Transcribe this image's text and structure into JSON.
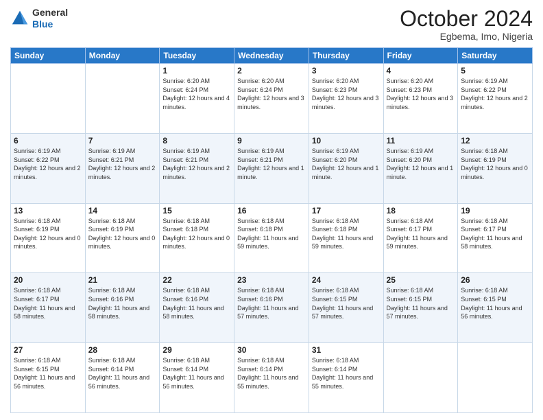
{
  "header": {
    "logo": {
      "line1": "General",
      "line2": "Blue"
    },
    "title": "October 2024",
    "location": "Egbema, Imo, Nigeria"
  },
  "days_of_week": [
    "Sunday",
    "Monday",
    "Tuesday",
    "Wednesday",
    "Thursday",
    "Friday",
    "Saturday"
  ],
  "weeks": [
    [
      {
        "day": "",
        "info": ""
      },
      {
        "day": "",
        "info": ""
      },
      {
        "day": "1",
        "info": "Sunrise: 6:20 AM\nSunset: 6:24 PM\nDaylight: 12 hours and 4 minutes."
      },
      {
        "day": "2",
        "info": "Sunrise: 6:20 AM\nSunset: 6:24 PM\nDaylight: 12 hours and 3 minutes."
      },
      {
        "day": "3",
        "info": "Sunrise: 6:20 AM\nSunset: 6:23 PM\nDaylight: 12 hours and 3 minutes."
      },
      {
        "day": "4",
        "info": "Sunrise: 6:20 AM\nSunset: 6:23 PM\nDaylight: 12 hours and 3 minutes."
      },
      {
        "day": "5",
        "info": "Sunrise: 6:19 AM\nSunset: 6:22 PM\nDaylight: 12 hours and 2 minutes."
      }
    ],
    [
      {
        "day": "6",
        "info": "Sunrise: 6:19 AM\nSunset: 6:22 PM\nDaylight: 12 hours and 2 minutes."
      },
      {
        "day": "7",
        "info": "Sunrise: 6:19 AM\nSunset: 6:21 PM\nDaylight: 12 hours and 2 minutes."
      },
      {
        "day": "8",
        "info": "Sunrise: 6:19 AM\nSunset: 6:21 PM\nDaylight: 12 hours and 2 minutes."
      },
      {
        "day": "9",
        "info": "Sunrise: 6:19 AM\nSunset: 6:21 PM\nDaylight: 12 hours and 1 minute."
      },
      {
        "day": "10",
        "info": "Sunrise: 6:19 AM\nSunset: 6:20 PM\nDaylight: 12 hours and 1 minute."
      },
      {
        "day": "11",
        "info": "Sunrise: 6:19 AM\nSunset: 6:20 PM\nDaylight: 12 hours and 1 minute."
      },
      {
        "day": "12",
        "info": "Sunrise: 6:18 AM\nSunset: 6:19 PM\nDaylight: 12 hours and 0 minutes."
      }
    ],
    [
      {
        "day": "13",
        "info": "Sunrise: 6:18 AM\nSunset: 6:19 PM\nDaylight: 12 hours and 0 minutes."
      },
      {
        "day": "14",
        "info": "Sunrise: 6:18 AM\nSunset: 6:19 PM\nDaylight: 12 hours and 0 minutes."
      },
      {
        "day": "15",
        "info": "Sunrise: 6:18 AM\nSunset: 6:18 PM\nDaylight: 12 hours and 0 minutes."
      },
      {
        "day": "16",
        "info": "Sunrise: 6:18 AM\nSunset: 6:18 PM\nDaylight: 11 hours and 59 minutes."
      },
      {
        "day": "17",
        "info": "Sunrise: 6:18 AM\nSunset: 6:18 PM\nDaylight: 11 hours and 59 minutes."
      },
      {
        "day": "18",
        "info": "Sunrise: 6:18 AM\nSunset: 6:17 PM\nDaylight: 11 hours and 59 minutes."
      },
      {
        "day": "19",
        "info": "Sunrise: 6:18 AM\nSunset: 6:17 PM\nDaylight: 11 hours and 58 minutes."
      }
    ],
    [
      {
        "day": "20",
        "info": "Sunrise: 6:18 AM\nSunset: 6:17 PM\nDaylight: 11 hours and 58 minutes."
      },
      {
        "day": "21",
        "info": "Sunrise: 6:18 AM\nSunset: 6:16 PM\nDaylight: 11 hours and 58 minutes."
      },
      {
        "day": "22",
        "info": "Sunrise: 6:18 AM\nSunset: 6:16 PM\nDaylight: 11 hours and 58 minutes."
      },
      {
        "day": "23",
        "info": "Sunrise: 6:18 AM\nSunset: 6:16 PM\nDaylight: 11 hours and 57 minutes."
      },
      {
        "day": "24",
        "info": "Sunrise: 6:18 AM\nSunset: 6:15 PM\nDaylight: 11 hours and 57 minutes."
      },
      {
        "day": "25",
        "info": "Sunrise: 6:18 AM\nSunset: 6:15 PM\nDaylight: 11 hours and 57 minutes."
      },
      {
        "day": "26",
        "info": "Sunrise: 6:18 AM\nSunset: 6:15 PM\nDaylight: 11 hours and 56 minutes."
      }
    ],
    [
      {
        "day": "27",
        "info": "Sunrise: 6:18 AM\nSunset: 6:15 PM\nDaylight: 11 hours and 56 minutes."
      },
      {
        "day": "28",
        "info": "Sunrise: 6:18 AM\nSunset: 6:14 PM\nDaylight: 11 hours and 56 minutes."
      },
      {
        "day": "29",
        "info": "Sunrise: 6:18 AM\nSunset: 6:14 PM\nDaylight: 11 hours and 56 minutes."
      },
      {
        "day": "30",
        "info": "Sunrise: 6:18 AM\nSunset: 6:14 PM\nDaylight: 11 hours and 55 minutes."
      },
      {
        "day": "31",
        "info": "Sunrise: 6:18 AM\nSunset: 6:14 PM\nDaylight: 11 hours and 55 minutes."
      },
      {
        "day": "",
        "info": ""
      },
      {
        "day": "",
        "info": ""
      }
    ]
  ]
}
